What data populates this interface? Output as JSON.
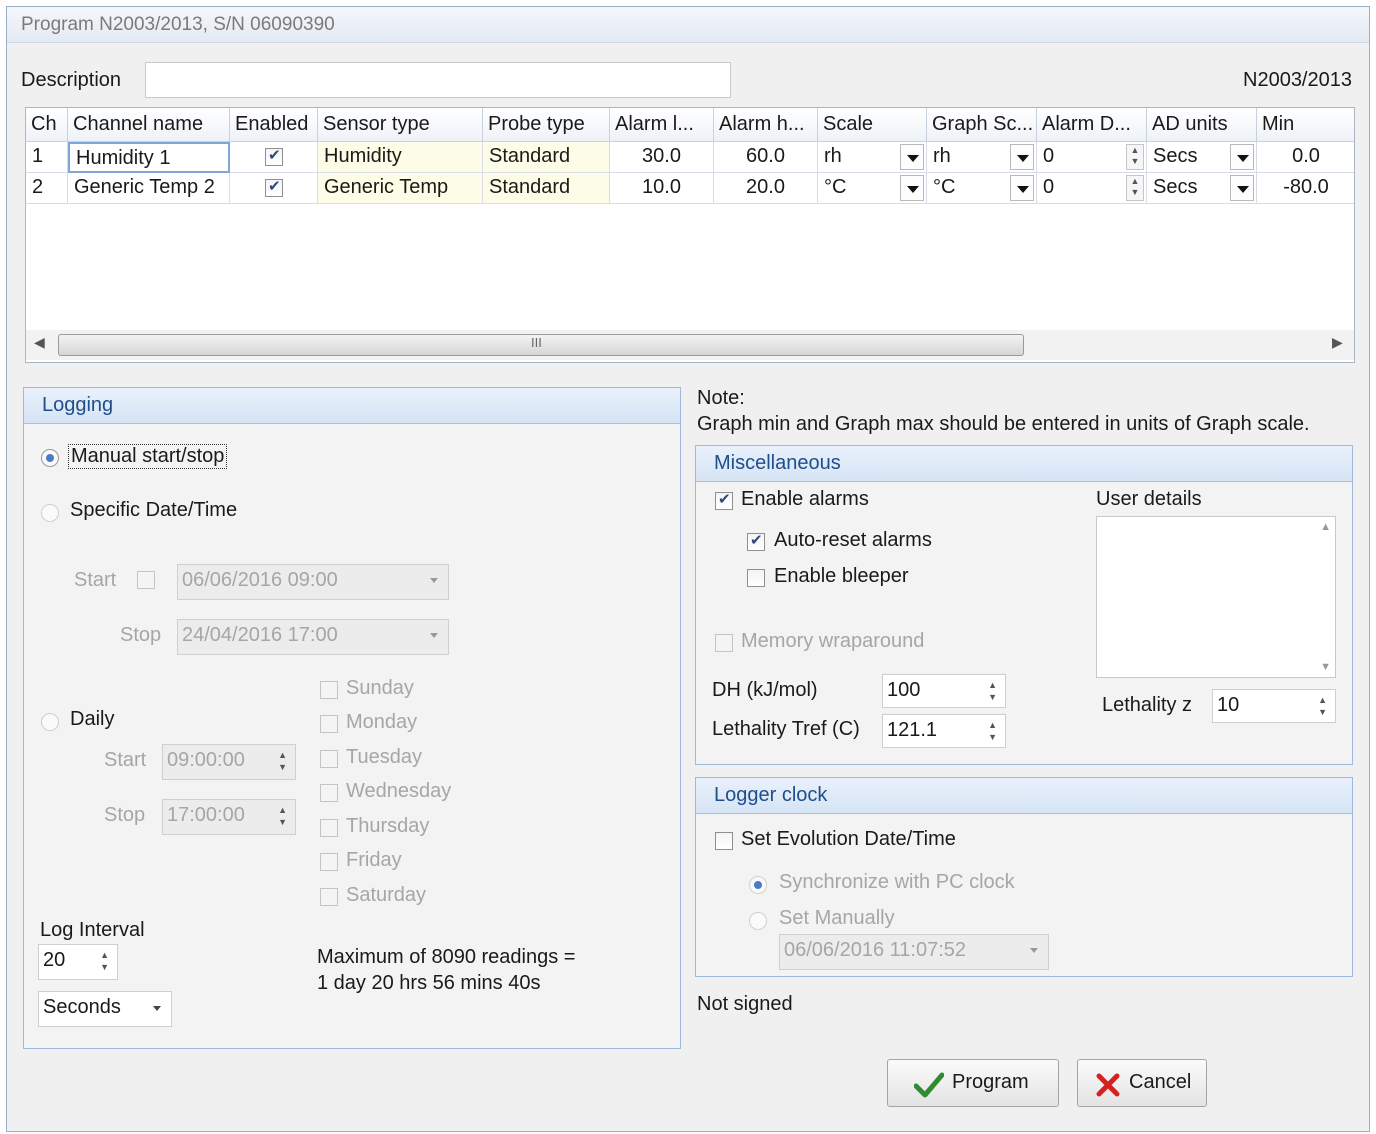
{
  "window": {
    "title": "Program N2003/2013, S/N 06090390"
  },
  "description": {
    "label": "Description",
    "value": "",
    "program_id": "N2003/2013"
  },
  "grid": {
    "columns": [
      "Ch",
      "Channel name",
      "Enabled",
      "Sensor type",
      "Probe type",
      "Alarm l...",
      "Alarm h...",
      "Scale",
      "Graph Sc...",
      "Alarm D...",
      "AD units",
      "Min"
    ],
    "rows": [
      {
        "ch": "1",
        "name": "Humidity 1",
        "enabled": true,
        "sensor": "Humidity",
        "probe": "Standard",
        "alarm_low": "30.0",
        "alarm_high": "60.0",
        "scale": "rh",
        "graph_scale": "rh",
        "alarm_delay": "0",
        "ad_units": "Secs",
        "min": "0.0"
      },
      {
        "ch": "2",
        "name": "Generic Temp 2",
        "enabled": true,
        "sensor": "Generic Temp",
        "probe": "Standard",
        "alarm_low": "10.0",
        "alarm_high": "20.0",
        "scale": "°C",
        "graph_scale": "°C",
        "alarm_delay": "0",
        "ad_units": "Secs",
        "min": "-80.0"
      }
    ],
    "scroll_thumb": "III"
  },
  "logging": {
    "title": "Logging",
    "manual": "Manual start/stop",
    "specific": "Specific Date/Time",
    "start_label": "Start",
    "start_value": "06/06/2016 09:00",
    "stop_label": "Stop",
    "stop_value": "24/04/2016 17:00",
    "daily": "Daily",
    "daily_start_label": "Start",
    "daily_start": "09:00:00",
    "daily_stop_label": "Stop",
    "daily_stop": "17:00:00",
    "days": [
      "Sunday",
      "Monday",
      "Tuesday",
      "Wednesday",
      "Thursday",
      "Friday",
      "Saturday"
    ],
    "interval_label": "Log Interval",
    "interval_value": "20",
    "interval_unit": "Seconds",
    "max_line1": "Maximum of 8090 readings =",
    "max_line2": "1 day 20 hrs 56 mins 40s"
  },
  "note": {
    "line1": "Note:",
    "line2": "Graph min and Graph max should be entered in units of Graph scale."
  },
  "misc": {
    "title": "Miscellaneous",
    "enable_alarms": "Enable alarms",
    "auto_reset": "Auto-reset alarms",
    "enable_bleeper": "Enable bleeper",
    "memory_wrap": "Memory wraparound",
    "user_details": "User details",
    "dh_label": "DH (kJ/mol)",
    "dh_value": "100",
    "tref_label": "Lethality Tref (C)",
    "tref_value": "121.1",
    "z_label": "Lethality z",
    "z_value": "10"
  },
  "clock": {
    "title": "Logger clock",
    "set_evolution": "Set Evolution Date/Time",
    "sync_pc": "Synchronize with PC clock",
    "set_manually": "Set Manually",
    "datetime": "06/06/2016 11:07:52"
  },
  "status": "Not signed",
  "buttons": {
    "program": "Program",
    "cancel": "Cancel"
  },
  "colors": {
    "panel_title": "#1f4e8c",
    "check_icon": "#2e8b2e",
    "cancel_icon": "#d42020"
  }
}
